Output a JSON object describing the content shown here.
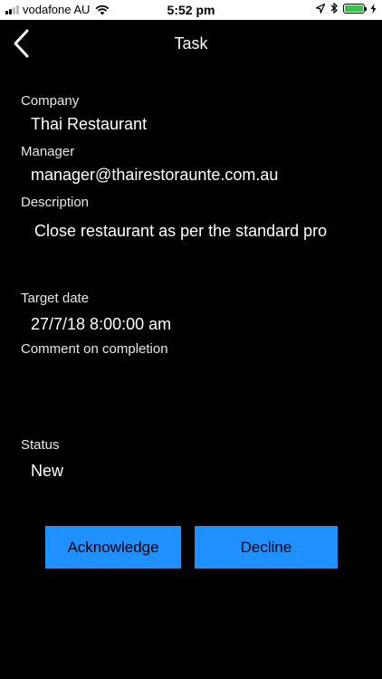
{
  "status_bar": {
    "carrier": "vodafone AU",
    "time": "5:52 pm",
    "battery_color": "#3bc24a"
  },
  "nav": {
    "title": "Task",
    "back_icon": "chevron-left-icon"
  },
  "fields": {
    "company_label": "Company",
    "company_value": "Thai Restaurant",
    "manager_label": "Manager",
    "manager_value": "manager@thairestoraunte.com.au",
    "description_label": "Description",
    "description_value": "Close restaurant as per the standard pro",
    "target_date_label": "Target date",
    "target_date_value": "27/7/18 8:00:00 am",
    "comment_label": "Comment on completion",
    "comment_value": "",
    "status_label": "Status",
    "status_value": "New"
  },
  "actions": {
    "acknowledge_label": "Acknowledge",
    "decline_label": "Decline",
    "accent_color": "#1e90ff"
  }
}
